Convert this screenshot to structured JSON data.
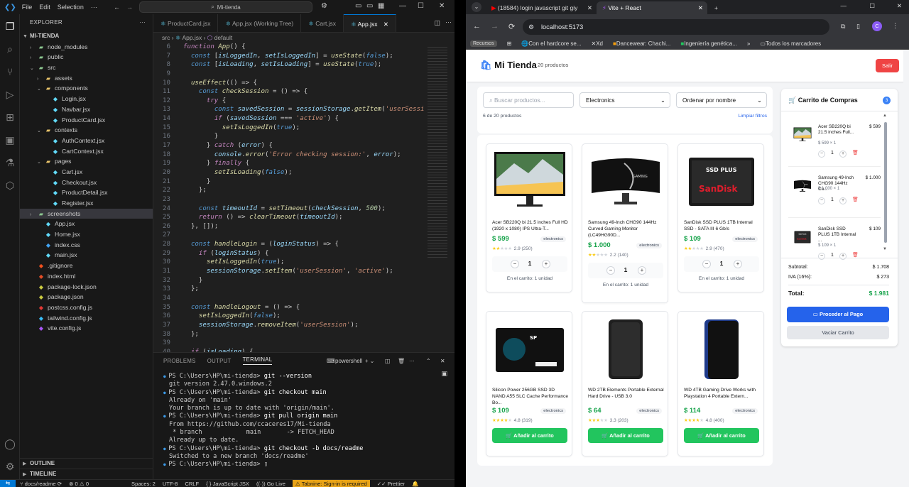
{
  "vscode": {
    "menu": [
      "File",
      "Edit",
      "Selection"
    ],
    "command_center": "Mi-tienda",
    "explorer_title": "EXPLORER",
    "root_folder": "MI-TIENDA",
    "tree": [
      {
        "label": "node_modules",
        "kind": "folder",
        "depth": 1,
        "open": false,
        "color": "#8dc891"
      },
      {
        "label": "public",
        "kind": "folder",
        "depth": 1,
        "open": false,
        "color": "#8dc891"
      },
      {
        "label": "src",
        "kind": "folder",
        "depth": 1,
        "open": true,
        "color": "#8dc891"
      },
      {
        "label": "assets",
        "kind": "folder",
        "depth": 2,
        "open": false,
        "color": "#e8c36a"
      },
      {
        "label": "components",
        "kind": "folder",
        "depth": 2,
        "open": true,
        "color": "#e8c36a"
      },
      {
        "label": "Login.jsx",
        "kind": "file",
        "depth": 3,
        "color": "#61dafb"
      },
      {
        "label": "Navbar.jsx",
        "kind": "file",
        "depth": 3,
        "color": "#61dafb"
      },
      {
        "label": "ProductCard.jsx",
        "kind": "file",
        "depth": 3,
        "color": "#61dafb"
      },
      {
        "label": "contexts",
        "kind": "folder",
        "depth": 2,
        "open": true,
        "color": "#e8c36a"
      },
      {
        "label": "AuthContext.jsx",
        "kind": "file",
        "depth": 3,
        "color": "#61dafb"
      },
      {
        "label": "CartContext.jsx",
        "kind": "file",
        "depth": 3,
        "color": "#61dafb"
      },
      {
        "label": "pages",
        "kind": "folder",
        "depth": 2,
        "open": true,
        "color": "#e8c36a"
      },
      {
        "label": "Cart.jsx",
        "kind": "file",
        "depth": 3,
        "color": "#61dafb"
      },
      {
        "label": "Checkout.jsx",
        "kind": "file",
        "depth": 3,
        "color": "#61dafb"
      },
      {
        "label": "ProductDetail.jsx",
        "kind": "file",
        "depth": 3,
        "color": "#61dafb"
      },
      {
        "label": "Register.jsx",
        "kind": "file",
        "depth": 3,
        "color": "#61dafb"
      },
      {
        "label": "screenshots",
        "kind": "folder",
        "depth": 1,
        "open": false,
        "color": "#8dc891",
        "selected": true
      },
      {
        "label": "App.jsx",
        "kind": "file",
        "depth": 2,
        "color": "#61dafb"
      },
      {
        "label": "Home.jsx",
        "kind": "file",
        "depth": 2,
        "color": "#61dafb"
      },
      {
        "label": "index.css",
        "kind": "file",
        "depth": 2,
        "color": "#42a5f5"
      },
      {
        "label": "main.jsx",
        "kind": "file",
        "depth": 2,
        "color": "#61dafb"
      },
      {
        "label": ".gitignore",
        "kind": "file",
        "depth": 1,
        "color": "#f4511e"
      },
      {
        "label": "index.html",
        "kind": "file",
        "depth": 1,
        "color": "#e44d26"
      },
      {
        "label": "package-lock.json",
        "kind": "file",
        "depth": 1,
        "color": "#cbcb41"
      },
      {
        "label": "package.json",
        "kind": "file",
        "depth": 1,
        "color": "#cbcb41"
      },
      {
        "label": "postcss.config.js",
        "kind": "file",
        "depth": 1,
        "color": "#e53935"
      },
      {
        "label": "tailwind.config.js",
        "kind": "file",
        "depth": 1,
        "color": "#38bdf8"
      },
      {
        "label": "vite.config.js",
        "kind": "file",
        "depth": 1,
        "color": "#a855f7"
      }
    ],
    "outline": "OUTLINE",
    "timeline": "TIMELINE",
    "tabs": [
      "ProductCard.jsx",
      "App.jsx (Working Tree)",
      "Cart.jsx",
      "App.jsx"
    ],
    "breadcrumb": [
      "src",
      "App.jsx",
      "default"
    ],
    "code_lines": [
      {
        "n": "6",
        "html": "<span class=\"kw it\">function</span> <span class=\"fn it\">App</span>() {"
      },
      {
        "n": "7",
        "html": "  <span class=\"bl it\">const</span> [<span class=\"vr it\">isLoggedIn</span>, <span class=\"vr it\">setIsLoggedIn</span>] = <span class=\"fn it\">useState</span>(<span class=\"bl it\">false</span>);"
      },
      {
        "n": "8",
        "html": "  <span class=\"bl it\">const</span> [<span class=\"vr it\">isLoading</span>, <span class=\"vr it\">setIsLoading</span>] = <span class=\"fn it\">useState</span>(<span class=\"bl it\">true</span>);"
      },
      {
        "n": "9",
        "html": ""
      },
      {
        "n": "10",
        "html": "  <span class=\"fn it\">useEffect</span>(() =&gt; {"
      },
      {
        "n": "11",
        "html": "    <span class=\"bl it\">const</span> <span class=\"fn it\">checkSession</span> = () =&gt; {"
      },
      {
        "n": "12",
        "html": "      <span class=\"kw it\">try</span> {"
      },
      {
        "n": "13",
        "html": "        <span class=\"bl it\">const</span> <span class=\"vr it\">savedSession</span> = <span class=\"vr it\">sessionStorage</span>.<span class=\"fn it\">getItem</span>(<span class=\"st it\">'userSessi</span>"
      },
      {
        "n": "14",
        "html": "        <span class=\"kw it\">if</span> (<span class=\"vr it\">savedSession</span> === <span class=\"st it\">'active'</span>) {"
      },
      {
        "n": "15",
        "html": "          <span class=\"fn it\">setIsLoggedIn</span>(<span class=\"bl it\">true</span>);"
      },
      {
        "n": "16",
        "html": "        }"
      },
      {
        "n": "17",
        "html": "      } <span class=\"kw it\">catch</span> (<span class=\"vr it\">error</span>) {"
      },
      {
        "n": "18",
        "html": "        <span class=\"vr it\">console</span>.<span class=\"fn it\">error</span>(<span class=\"st it\">'Error checking session:'</span>, <span class=\"vr it\">error</span>);"
      },
      {
        "n": "19",
        "html": "      } <span class=\"kw it\">finally</span> {"
      },
      {
        "n": "20",
        "html": "        <span class=\"fn it\">setIsLoading</span>(<span class=\"bl it\">false</span>);"
      },
      {
        "n": "21",
        "html": "      }"
      },
      {
        "n": "22",
        "html": "    };"
      },
      {
        "n": "23",
        "html": ""
      },
      {
        "n": "24",
        "html": "    <span class=\"bl it\">const</span> <span class=\"vr it\">timeoutId</span> = <span class=\"fn it\">setTimeout</span>(<span class=\"vr it\">checkSession</span>, <span class=\"nm it\">500</span>);"
      },
      {
        "n": "25",
        "html": "    <span class=\"kw it\">return</span> () =&gt; <span class=\"fn it\">clearTimeout</span>(<span class=\"vr it\">timeoutId</span>);"
      },
      {
        "n": "26",
        "html": "  }, []);"
      },
      {
        "n": "27",
        "html": ""
      },
      {
        "n": "28",
        "html": "  <span class=\"bl it\">const</span> <span class=\"fn it\">handleLogin</span> = (<span class=\"vr it\">loginStatus</span>) =&gt; {"
      },
      {
        "n": "29",
        "html": "    <span class=\"kw it\">if</span> (<span class=\"vr it\">loginStatus</span>) {"
      },
      {
        "n": "30",
        "html": "      <span class=\"fn it\">setIsLoggedIn</span>(<span class=\"bl it\">true</span>);"
      },
      {
        "n": "31",
        "html": "      <span class=\"vr it\">sessionStorage</span>.<span class=\"fn it\">setItem</span>(<span class=\"st it\">'userSession'</span>, <span class=\"st it\">'active'</span>);"
      },
      {
        "n": "32",
        "html": "    }"
      },
      {
        "n": "33",
        "html": "  };"
      },
      {
        "n": "34",
        "html": ""
      },
      {
        "n": "35",
        "html": "  <span class=\"bl it\">const</span> <span class=\"fn it\">handleLogout</span> = () =&gt; {"
      },
      {
        "n": "36",
        "html": "    <span class=\"fn it\">setIsLoggedIn</span>(<span class=\"bl it\">false</span>);"
      },
      {
        "n": "37",
        "html": "    <span class=\"vr it\">sessionStorage</span>.<span class=\"fn it\">removeItem</span>(<span class=\"st it\">'userSession'</span>);"
      },
      {
        "n": "38",
        "html": "  };"
      },
      {
        "n": "39",
        "html": ""
      },
      {
        "n": "40",
        "html": "  <span class=\"kw it\">if</span> (<span class=\"vr it\">isLoading</span>) {"
      }
    ],
    "panel_tabs": [
      "PROBLEMS",
      "OUTPUT",
      "TERMINAL"
    ],
    "terminal_shell": "powershell",
    "terminal_lines": [
      {
        "prompt": "PS C:\\Users\\HP\\mi-tienda> ",
        "cmd": "git --version"
      },
      {
        "out": "git version 2.47.0.windows.2"
      },
      {
        "prompt": "PS C:\\Users\\HP\\mi-tienda> ",
        "cmd": "git checkout main"
      },
      {
        "out": "Already on 'main'"
      },
      {
        "out": "Your branch is up to date with 'origin/main'."
      },
      {
        "prompt": "PS C:\\Users\\HP\\mi-tienda> ",
        "cmd": "git pull origin main"
      },
      {
        "out": "From https://github.com/ccaceres17/Mi-tienda"
      },
      {
        "out": " * branch            main       -> FETCH_HEAD"
      },
      {
        "out": "Already up to date."
      },
      {
        "prompt": "PS C:\\Users\\HP\\mi-tienda> ",
        "cmd": "git checkout -b docs/readme"
      },
      {
        "out": "Switched to a new branch 'docs/readme'"
      },
      {
        "prompt": "PS C:\\Users\\HP\\mi-tienda> ",
        "cmd": ""
      }
    ],
    "status": {
      "branch": "docs/readme",
      "errors": "0",
      "warnings": "0",
      "spaces": "Spaces: 2",
      "encoding": "UTF-8",
      "eol": "CRLF",
      "language": "JavaScript JSX",
      "golive": "Go Live",
      "tabnine": "Tabnine: Sign-in is required",
      "prettier": "Prettier"
    }
  },
  "chrome": {
    "tabs": [
      "(18584) login javascript git giy",
      "Vite + React"
    ],
    "url": "localhost:5173",
    "bookmarks": [
      "Con el hardcore se...",
      "Xd",
      "Dancewear: Chachi...",
      "Ingeniería genética..."
    ],
    "all_bookmarks": "Todos los marcadores",
    "profile_initial": "C"
  },
  "shop": {
    "title": "Mi Tienda",
    "count": "20 productos",
    "logout": "Salir",
    "search_placeholder": "Buscar productos...",
    "category": "Electronics",
    "sort": "Ordenar por nombre",
    "showing": "6 de 20 productos",
    "clear": "Limpiar filtros",
    "add_label": "Añadir al carrito",
    "products": [
      {
        "name": "Acer SB220Q bi 21.5 inches Full HD (1920 x 1080) IPS Ultra-T...",
        "price": "$ 599",
        "category": "electronics",
        "stars": 2,
        "rating": "2.9 (250)",
        "qty": "1",
        "in_cart": "En el carrito: 1 unidad",
        "image": "monitor-landscape"
      },
      {
        "name": "Samsung 49-Inch CHG90 144Hz Curved Gaming Monitor (LC49HG90D...",
        "price": "$ 1.000",
        "category": "electronics",
        "stars": 2,
        "rating": "2.2 (140)",
        "qty": "1",
        "in_cart": "En el carrito: 1 unidad",
        "image": "curved-monitor"
      },
      {
        "name": "SanDisk SSD PLUS 1TB Internal SSD - SATA III 6 Gb/s",
        "price": "$ 109",
        "category": "electronics",
        "stars": 2,
        "rating": "2.9 (470)",
        "qty": "1",
        "in_cart": "En el carrito: 1 unidad",
        "image": "sandisk-ssd"
      },
      {
        "name": "Silicon Power 256GB SSD 3D NAND A55 SLC Cache Performance Bo...",
        "price": "$ 109",
        "category": "electronics",
        "stars": 4,
        "rating": "4.8 (319)",
        "image": "sp-ssd"
      },
      {
        "name": "WD 2TB Elements Portable External Hard Drive - USB 3.0",
        "price": "$ 64",
        "category": "electronics",
        "stars": 3,
        "rating": "3.3 (203)",
        "image": "wd-black"
      },
      {
        "name": "WD 4TB Gaming Drive Works with Playstation 4 Portable Extern...",
        "price": "$ 114",
        "category": "electronics",
        "stars": 4,
        "rating": "4.8 (400)",
        "image": "wd-blue"
      }
    ],
    "cart": {
      "title": "Carrito de Compras",
      "badge": "3",
      "items": [
        {
          "name": "Acer SB220Q bi 21.5 inches Full...",
          "price": "$ 599",
          "mult": "$ 599 × 1",
          "qty": "1"
        },
        {
          "name": "Samsung 49-Inch CHG90 144Hz Cu...",
          "price": "$ 1.000",
          "mult": "$ 1.000 × 1",
          "qty": "1"
        },
        {
          "name": "SanDisk SSD PLUS 1TB Internal ...",
          "price": "$ 109",
          "mult": "$ 109 × 1",
          "qty": "1"
        }
      ],
      "subtotal_label": "Subtotal:",
      "subtotal": "$ 1.708",
      "iva_label": "IVA (16%):",
      "iva": "$ 273",
      "total_label": "Total:",
      "total": "$ 1.981",
      "checkout": "Proceder al Pago",
      "empty": "Vaciar Carrito"
    }
  }
}
